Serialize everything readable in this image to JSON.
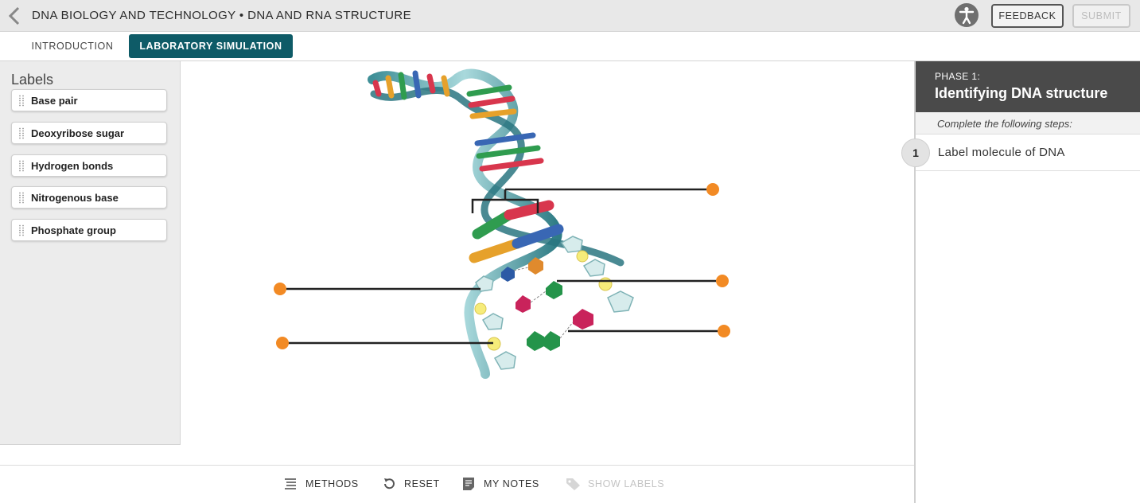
{
  "header": {
    "title": "DNA BIOLOGY AND TECHNOLOGY • DNA AND RNA STRUCTURE",
    "feedback_label": "FEEDBACK",
    "submit_label": "SUBMIT",
    "back_icon": "chevron-left-icon",
    "accessibility_icon": "accessibility-icon"
  },
  "tabs": [
    {
      "label": "INTRODUCTION",
      "active": false
    },
    {
      "label": "LABORATORY SIMULATION",
      "active": true
    }
  ],
  "labels_panel": {
    "title": "Labels",
    "items": [
      {
        "label": "Base pair"
      },
      {
        "label": "Deoxyribose sugar"
      },
      {
        "label": "Hydrogen bonds"
      },
      {
        "label": "Nitrogenous base"
      },
      {
        "label": "Phosphate group"
      }
    ]
  },
  "diagram": {
    "drop_targets": 5,
    "accent_color": "#f28a24"
  },
  "toolbar": {
    "methods_label": "METHODS",
    "reset_label": "RESET",
    "notes_label": "MY NOTES",
    "show_labels_label": "SHOW LABELS"
  },
  "right_panel": {
    "phase_label": "PHASE 1:",
    "phase_title": "Identifying DNA structure",
    "steps_hint": "Complete the following steps:",
    "steps": [
      {
        "number": "1",
        "text": "Label molecule of DNA"
      }
    ]
  },
  "colors": {
    "header_bg": "#e8e8e8",
    "active_tab": "#0e5b67",
    "phase_bg": "#4a4a4a",
    "drop_target": "#f28a24"
  }
}
